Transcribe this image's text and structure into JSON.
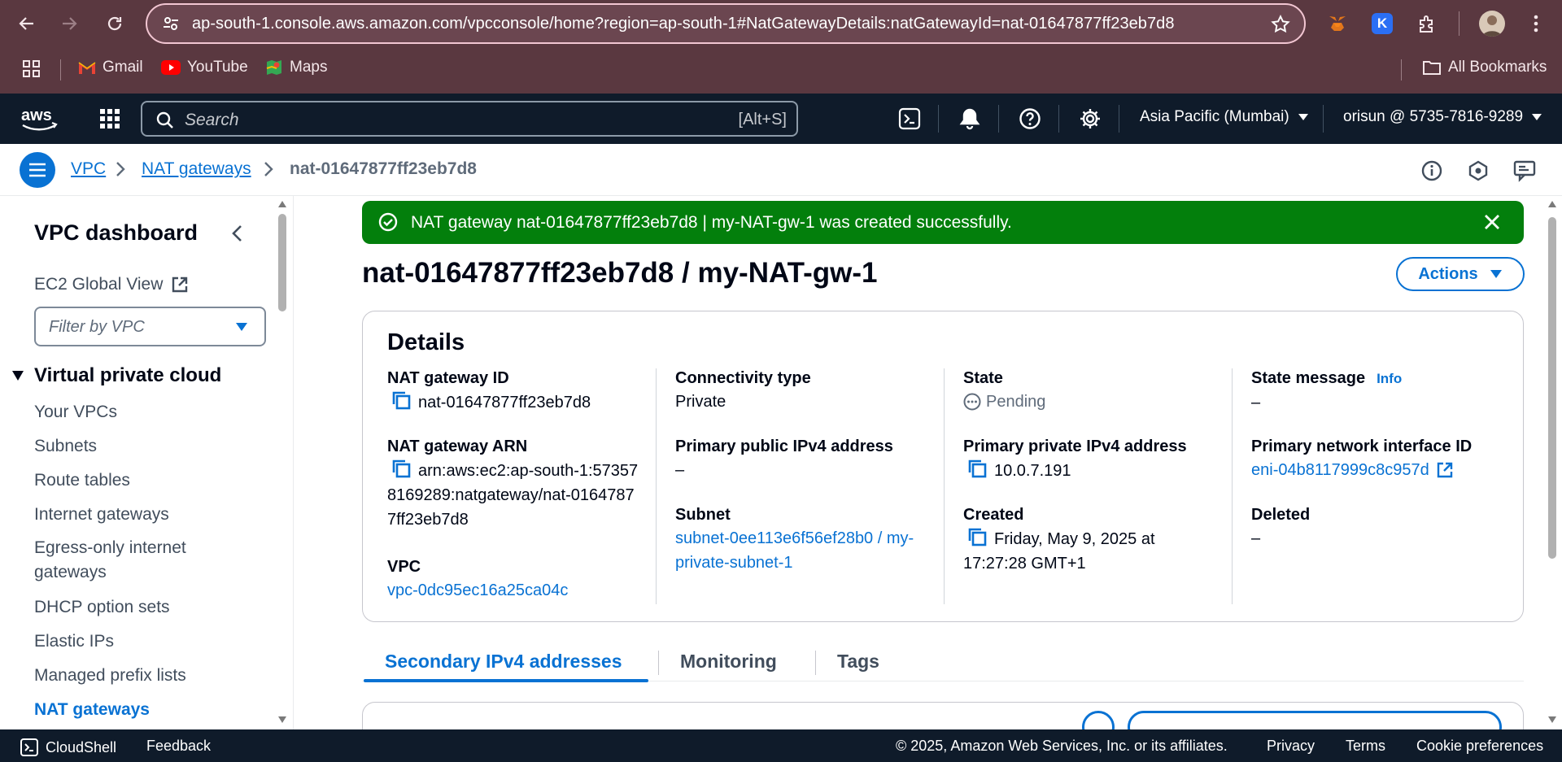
{
  "browser": {
    "url": "ap-south-1.console.aws.amazon.com/vpcconsole/home?region=ap-south-1#NatGatewayDetails:natGatewayId=nat-01647877ff23eb7d8",
    "bookmarks": [
      {
        "label": "Gmail"
      },
      {
        "label": "YouTube"
      },
      {
        "label": "Maps"
      }
    ],
    "all_bookmarks": "All Bookmarks"
  },
  "aws_nav": {
    "search_placeholder": "Search",
    "search_shortcut": "[Alt+S]",
    "region": "Asia Pacific (Mumbai)",
    "account": "orisun @ 5735-7816-9289"
  },
  "breadcrumb": {
    "items": [
      "VPC",
      "NAT gateways"
    ],
    "current": "nat-01647877ff23eb7d8"
  },
  "sidebar": {
    "title": "VPC dashboard",
    "ec2_global": "EC2 Global View",
    "filter_placeholder": "Filter by VPC",
    "section": "Virtual private cloud",
    "items": [
      {
        "label": "Your VPCs"
      },
      {
        "label": "Subnets"
      },
      {
        "label": "Route tables"
      },
      {
        "label": "Internet gateways"
      },
      {
        "label": "Egress-only internet gateways"
      },
      {
        "label": "DHCP option sets"
      },
      {
        "label": "Elastic IPs"
      },
      {
        "label": "Managed prefix lists"
      },
      {
        "label": "NAT gateways"
      }
    ]
  },
  "flash": {
    "message": "NAT gateway nat-01647877ff23eb7d8 | my-NAT-gw-1 was created successfully."
  },
  "page": {
    "title": "nat-01647877ff23eb7d8 / my-NAT-gw-1",
    "actions": "Actions"
  },
  "details": {
    "title": "Details",
    "nat_id_label": "NAT gateway ID",
    "nat_id": "nat-01647877ff23eb7d8",
    "arn_label": "NAT gateway ARN",
    "arn": "arn:aws:ec2:ap-south-1:573578169289:natgateway/nat-01647877ff23eb7d8",
    "vpc_label": "VPC",
    "vpc": "vpc-0dc95ec16a25ca04c",
    "connectivity_label": "Connectivity type",
    "connectivity": "Private",
    "public_ip_label": "Primary public IPv4 address",
    "public_ip": "–",
    "subnet_label": "Subnet",
    "subnet": "subnet-0ee113e6f56ef28b0 / my-private-subnet-1",
    "state_label": "State",
    "state": "Pending",
    "private_ip_label": "Primary private IPv4 address",
    "private_ip": "10.0.7.191",
    "created_label": "Created",
    "created": "Friday, May 9, 2025 at 17:27:28 GMT+1",
    "state_message_label": "State message",
    "info": "Info",
    "state_message": "–",
    "eni_label": "Primary network interface ID",
    "eni": "eni-04b8117999c8c957d",
    "deleted_label": "Deleted",
    "deleted": "–"
  },
  "tabs": [
    "Secondary IPv4 addresses",
    "Monitoring",
    "Tags"
  ],
  "footer": {
    "cloudshell": "CloudShell",
    "feedback": "Feedback",
    "copyright": "© 2025, Amazon Web Services, Inc. or its affiliates.",
    "privacy": "Privacy",
    "terms": "Terms",
    "cookies": "Cookie preferences"
  },
  "colors": {
    "accent": "#0972d3",
    "success": "#037f0c",
    "nav_bg": "#0f1b2a",
    "chrome_bg": "#5a3840"
  },
  "icons": [
    "back-icon",
    "forward-icon",
    "reload-icon",
    "site-info-icon",
    "star-icon",
    "apps-icon",
    "search-icon",
    "cloudshell-icon",
    "bell-icon",
    "help-icon",
    "gear-icon",
    "menu-icon",
    "chevron-right-icon",
    "info-icon",
    "copy-icon",
    "external-link-icon",
    "check-circle-icon",
    "close-icon",
    "caret-down-icon",
    "pending-icon"
  ]
}
